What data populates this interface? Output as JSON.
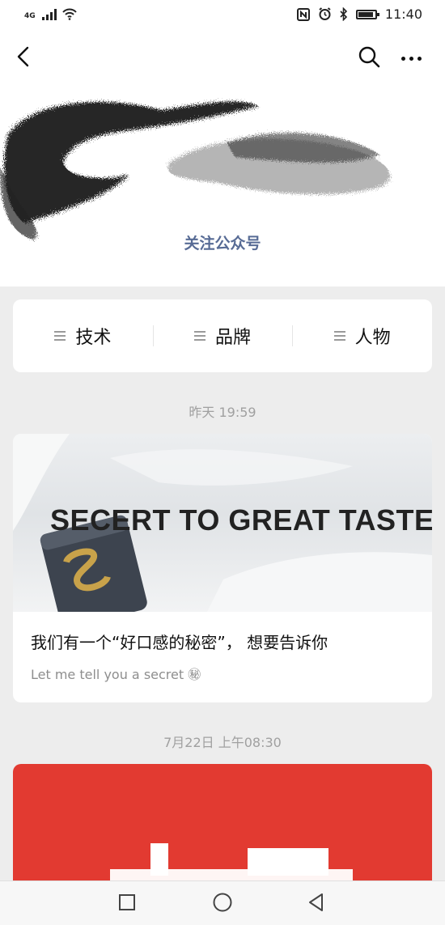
{
  "status_bar": {
    "network": "4G",
    "time": "11:40"
  },
  "header": {
    "follow_label": "关注公众号"
  },
  "menu": [
    {
      "label": "技术"
    },
    {
      "label": "品牌"
    },
    {
      "label": "人物"
    }
  ],
  "articles": [
    {
      "timestamp": "昨天 19:59",
      "cover_text": "SECERT TO GREAT TASTE",
      "title": "我们有一个“好口感的秘密”， 想要告诉你",
      "subtitle": "Let me tell you a secret ㊙"
    },
    {
      "timestamp": "7月22日 上午08:30"
    }
  ],
  "colors": {
    "link": "#576b95",
    "background": "#ededed",
    "card2_red": "#e23a31"
  },
  "icons": [
    "back-arrow-icon",
    "search-icon",
    "more-icon",
    "menu-list-icon",
    "square-nav-icon",
    "circle-nav-icon",
    "triangle-back-nav-icon"
  ]
}
